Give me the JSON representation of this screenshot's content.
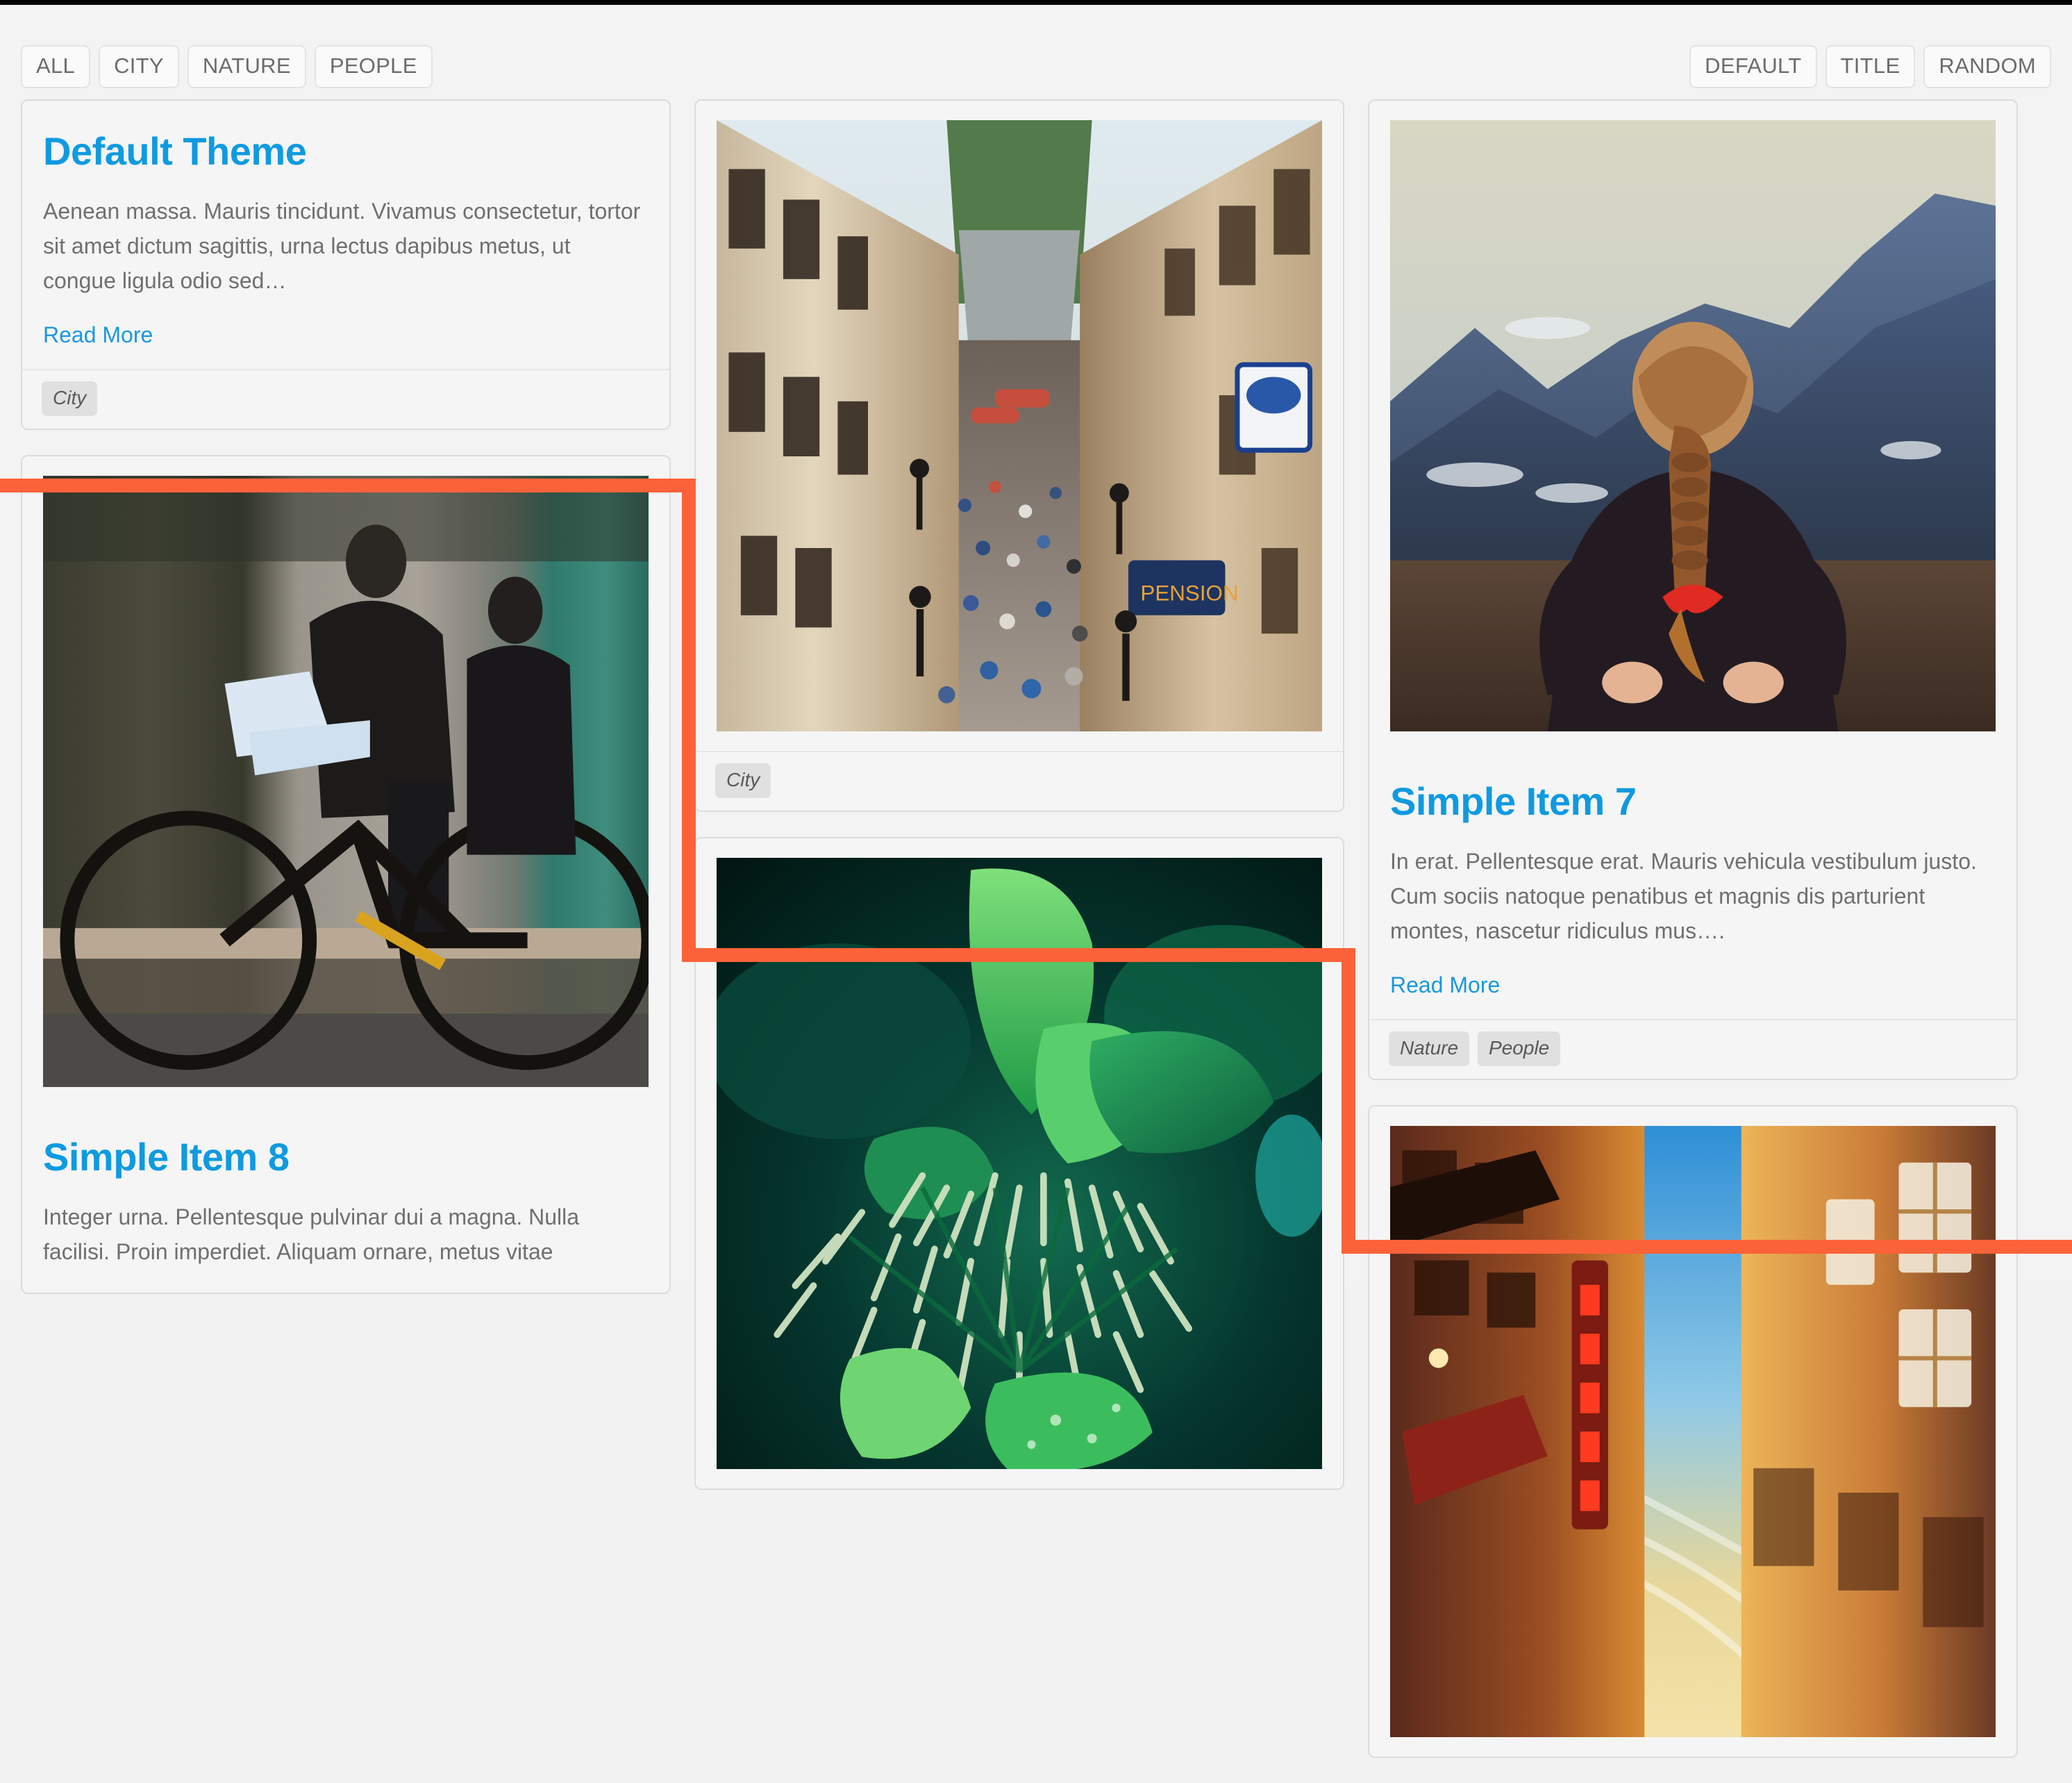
{
  "accent": {
    "link_blue": "#0f9ae0",
    "highlight_orange": "#fc6239",
    "page_bg": "#f3f3f3",
    "card_bg": "#f5f5f5",
    "card_border": "#dcdcdc",
    "tag_bg": "#e0e0e0",
    "text_gray": "#6f6f6f"
  },
  "controls": {
    "filters": [
      {
        "label": "ALL",
        "name": "filter-all"
      },
      {
        "label": "CITY",
        "name": "filter-city"
      },
      {
        "label": "NATURE",
        "name": "filter-nature"
      },
      {
        "label": "PEOPLE",
        "name": "filter-people"
      }
    ],
    "sorts": [
      {
        "label": "DEFAULT",
        "name": "sort-default"
      },
      {
        "label": "TITLE",
        "name": "sort-title"
      },
      {
        "label": "RANDOM",
        "name": "sort-random"
      }
    ]
  },
  "read_more_label": "Read More",
  "cards": {
    "default_theme": {
      "title": "Default Theme",
      "text": "Aenean massa. Mauris tincidunt. Vivamus consectetur, tortor sit amet dictum sagittis, urna lectus dapibus metus, ut congue ligula odio sed…",
      "read_more": "Read More",
      "tags": [
        "City"
      ]
    },
    "simple_item_8": {
      "title": "Simple Item 8",
      "text": "Integer urna. Pellentesque pulvinar dui a magna. Nulla facilisi. Proin imperdiet. Aliquam ornare, metus vitae",
      "image_alt": "man-on-bicycle-photo",
      "tags": []
    },
    "city_street": {
      "image_alt": "crowded-old-town-street-photo",
      "tags": [
        "City"
      ]
    },
    "green_leaves": {
      "image_alt": "green-leaves-macro-photo",
      "tags": []
    },
    "simple_item_7": {
      "title": "Simple Item 7",
      "text": "In erat. Pellentesque erat. Mauris vehicula vestibulum justo. Cum sociis natoque penatibus et magnis dis parturient montes, nascetur ridiculus mus….",
      "read_more": "Read More",
      "image_alt": "woman-with-braid-facing-mountains-photo",
      "tags": [
        "Nature",
        "People"
      ]
    },
    "sunset_alley": {
      "image_alt": "sunset-city-alley-with-neon-sign-photo",
      "tags": []
    }
  }
}
